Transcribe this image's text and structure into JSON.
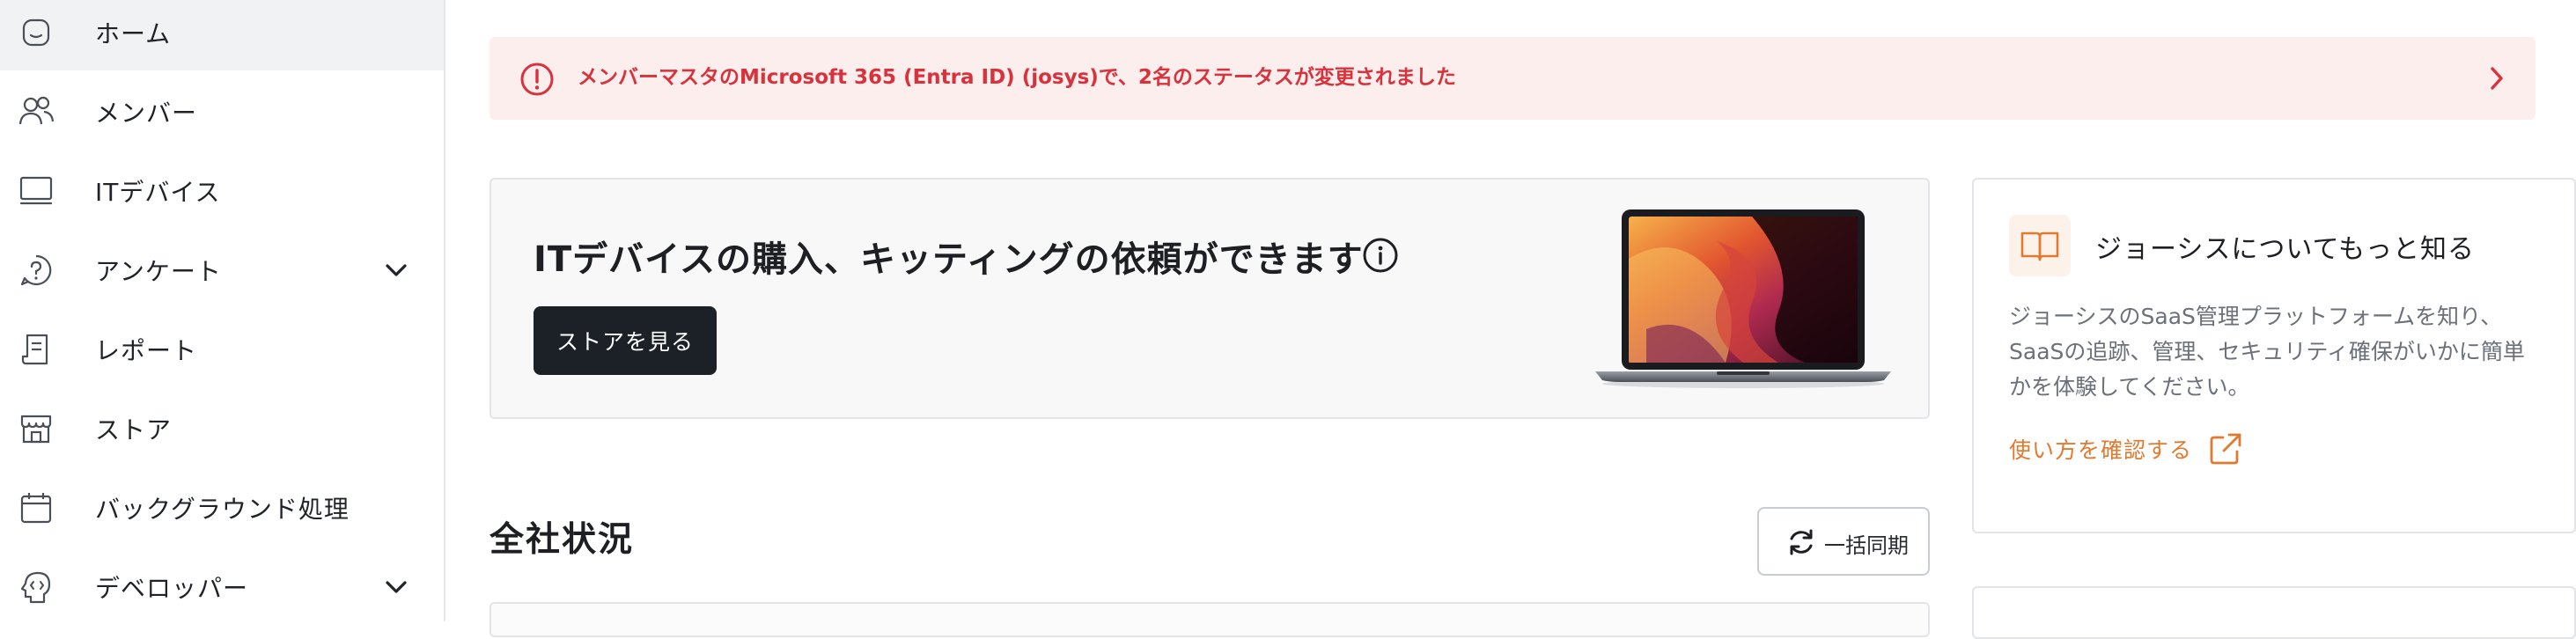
{
  "sidebar": {
    "items": [
      {
        "label": "ホーム",
        "icon": "home-icon",
        "active": true
      },
      {
        "label": "メンバー",
        "icon": "members-icon"
      },
      {
        "label": "ITデバイス",
        "icon": "laptop-icon"
      },
      {
        "label": "アンケート",
        "icon": "question-icon",
        "expandable": true
      },
      {
        "label": "レポート",
        "icon": "report-icon"
      },
      {
        "label": "ストア",
        "icon": "store-icon"
      },
      {
        "label": "バックグラウンド処理",
        "icon": "calendar-icon"
      },
      {
        "label": "デベロッパー",
        "icon": "developer-icon",
        "expandable": true
      }
    ]
  },
  "alert": {
    "message": "メンバーマスタのMicrosoft 365 (Entra ID) (josys)で、2名のステータスが変更されました",
    "color": "#d8323c",
    "background": "#fbeeed"
  },
  "store_card": {
    "title": "ITデバイスの購入、キッティングの依頼ができます",
    "button_label": "ストアを見る"
  },
  "section": {
    "title": "全社状況",
    "sync_button_label": "一括同期"
  },
  "info_card": {
    "title": "ジョーシスについてもっと知る",
    "description": "ジョーシスのSaaS管理プラットフォームを知り、SaaSの追跡、管理、セキュリティ確保がいかに簡単かを体験してください。",
    "link_label": "使い方を確認する",
    "accent": "#e07a2f"
  }
}
